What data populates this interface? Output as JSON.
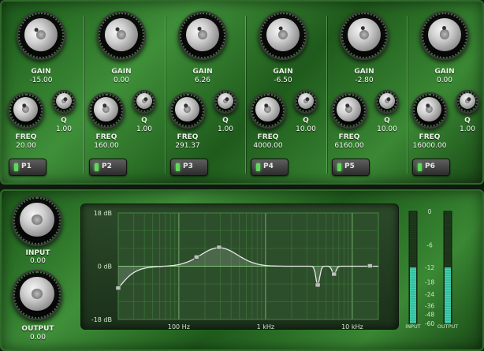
{
  "bands": [
    {
      "gain_label": "GAIN",
      "gain": "-15.00",
      "freq_label": "FREQ",
      "freq": "20.00",
      "q_label": "Q",
      "q": "1.00",
      "button": "P1",
      "shape": "shelf"
    },
    {
      "gain_label": "GAIN",
      "gain": "0.00",
      "freq_label": "FREQ",
      "freq": "160.00",
      "q_label": "Q",
      "q": "1.00",
      "button": "P2",
      "shape": "peak"
    },
    {
      "gain_label": "GAIN",
      "gain": "6.26",
      "freq_label": "FREQ",
      "freq": "291.37",
      "q_label": "Q",
      "q": "1.00",
      "button": "P3",
      "shape": "peak"
    },
    {
      "gain_label": "GAIN",
      "gain": "-6.50",
      "freq_label": "FREQ",
      "freq": "4000.00",
      "q_label": "Q",
      "q": "10.00",
      "button": "P4",
      "shape": "peak"
    },
    {
      "gain_label": "GAIN",
      "gain": "-2.80",
      "freq_label": "FREQ",
      "freq": "6160.00",
      "q_label": "Q",
      "q": "10.00",
      "button": "P5",
      "shape": "peak"
    },
    {
      "gain_label": "GAIN",
      "gain": "0.00",
      "freq_label": "FREQ",
      "freq": "16000.00",
      "q_label": "Q",
      "q": "1.00",
      "button": "P6",
      "shape": "shelf"
    }
  ],
  "io": {
    "input_label": "INPUT",
    "input_value": "0.00",
    "output_label": "OUTPUT",
    "output_value": "0.00"
  },
  "graph": {
    "y_labels": [
      "18 dB",
      "0 dB",
      "-18 dB"
    ],
    "x_labels": [
      "100 Hz",
      "1 kHz",
      "10 kHz"
    ],
    "curve_color": "#e8e8e8",
    "grid_color": "#3e7a3b"
  },
  "meters": {
    "scale": [
      "0",
      "-6",
      "-12",
      "-18",
      "-24",
      "-36",
      "-48",
      "-60"
    ],
    "input_label": "INPUT",
    "output_label": "OUTPUT",
    "input_level_db": -12,
    "output_level_db": -12
  },
  "colors": {
    "panel": "#2f7a2b",
    "text": "#eaf4e6",
    "led": "#5fd85a"
  }
}
